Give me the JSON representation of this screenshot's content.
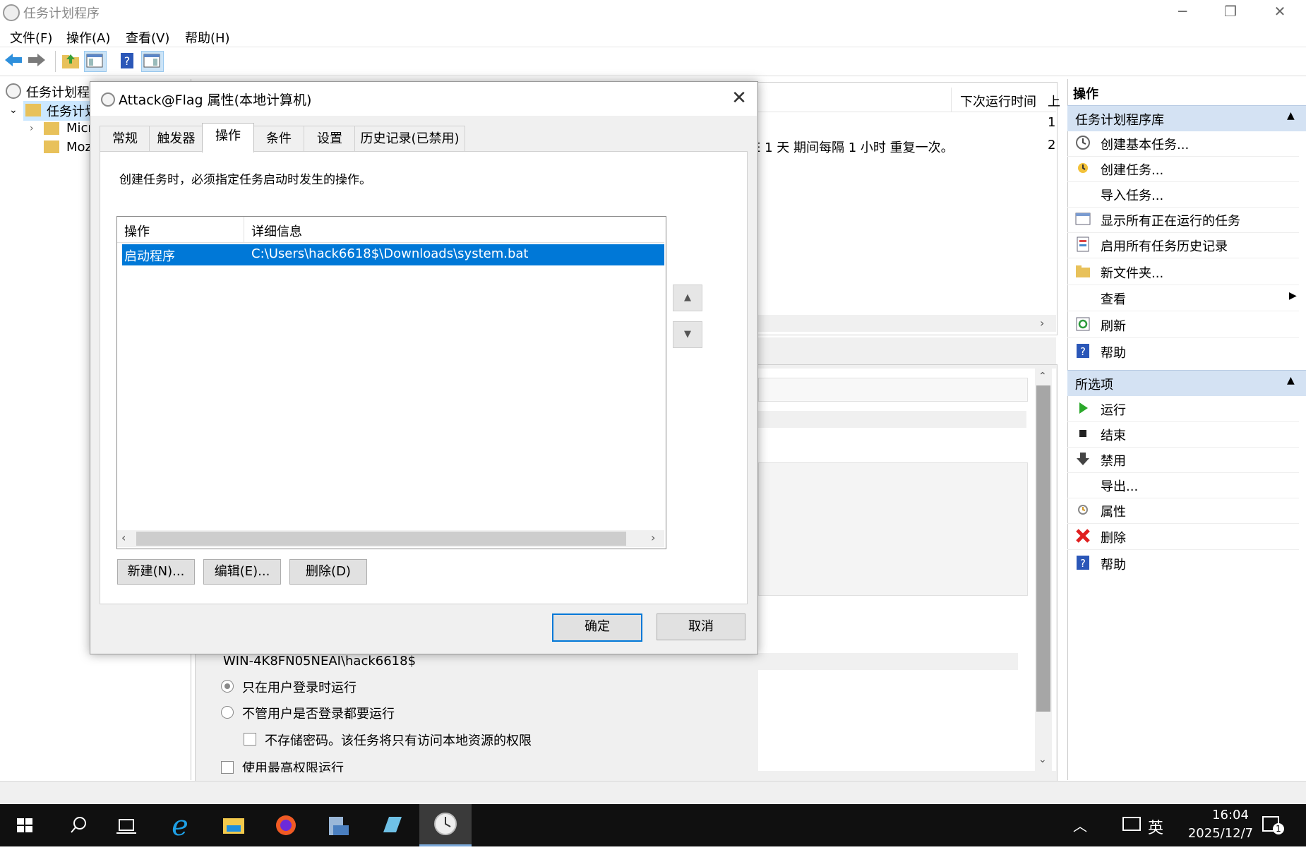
{
  "app": {
    "title": "任务计划程序",
    "menu": [
      "文件(F)",
      "操作(A)",
      "查看(V)",
      "帮助(H)"
    ]
  },
  "tree": {
    "root": "任务计划程",
    "library": "任务计划",
    "children": [
      "Micr",
      "Moz"
    ]
  },
  "center": {
    "next_run_header": "下次运行时间",
    "next_run_header_cut": "上",
    "row_fragment": "E 1 天 期间每隔 1 小时 重复一次。",
    "row_nums": [
      "1",
      "2"
    ],
    "account": "WIN-4K8FN05NEAI\\hack6618$",
    "radio_logged_on": "只在用户登录时运行",
    "radio_whether": "不管用户是否登录都要运行",
    "no_store_password": "不存储密码。该任务将只有访问本地资源的权限",
    "highest_privileges": "使用最高权限运行"
  },
  "actions": {
    "title": "操作",
    "section1": "任务计划程序库",
    "section1_items": [
      "创建基本任务...",
      "创建任务...",
      "导入任务...",
      "显示所有正在运行的任务",
      "启用所有任务历史记录",
      "新文件夹...",
      "查看",
      "刷新",
      "帮助"
    ],
    "section2": "所选项",
    "section2_items": [
      "运行",
      "结束",
      "禁用",
      "导出...",
      "属性",
      "删除",
      "帮助"
    ]
  },
  "dialog": {
    "title": "Attack@Flag 属性(本地计算机)",
    "tabs": [
      "常规",
      "触发器",
      "操作",
      "条件",
      "设置",
      "历史记录(已禁用)"
    ],
    "selected_tab": "操作",
    "description": "创建任务时，必须指定任务启动时发生的操作。",
    "columns": [
      "操作",
      "详细信息"
    ],
    "rows": [
      {
        "action": "启动程序",
        "details": "C:\\Users\\hack6618$\\Downloads\\system.bat"
      }
    ],
    "buttons": {
      "new": "新建(N)...",
      "edit": "编辑(E)...",
      "delete": "删除(D)"
    },
    "ok": "确定",
    "cancel": "取消"
  },
  "taskbar": {
    "time": "16:04",
    "date": "2025/12/7",
    "ime": "英",
    "notification_count": "1"
  }
}
